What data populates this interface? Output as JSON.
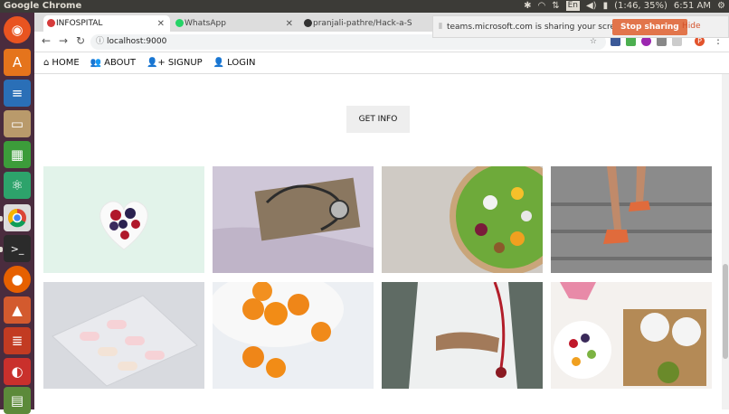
{
  "system": {
    "app_name": "Google Chrome",
    "language": "En",
    "battery": "(1:46, 35%)",
    "clock": "6:51 AM"
  },
  "browser": {
    "tabs": [
      {
        "label": "INFOSPITAL",
        "active": true
      },
      {
        "label": "WhatsApp",
        "active": false
      },
      {
        "label": "pranjali-pathre/Hack-a-S",
        "active": false
      }
    ],
    "url": "localhost:9000",
    "share_notice": "teams.microsoft.com is sharing your screen.",
    "stop_sharing": "Stop sharing",
    "hide": "Hide",
    "profile_initial": "P"
  },
  "navbar": {
    "items": [
      {
        "label": "HOME",
        "icon": "home-icon"
      },
      {
        "label": "ABOUT",
        "icon": "users-icon"
      },
      {
        "label": "SIGNUP",
        "icon": "user-plus-icon"
      },
      {
        "label": "LOGIN",
        "icon": "user-icon"
      }
    ]
  },
  "main": {
    "get_info_label": "GET INFO"
  },
  "colors": {
    "launcher_bg": "#4a2c3e",
    "topbar_bg": "#3c3b37",
    "stop_sharing": "#e2754b",
    "tab_favicon": "#d63b3b"
  }
}
